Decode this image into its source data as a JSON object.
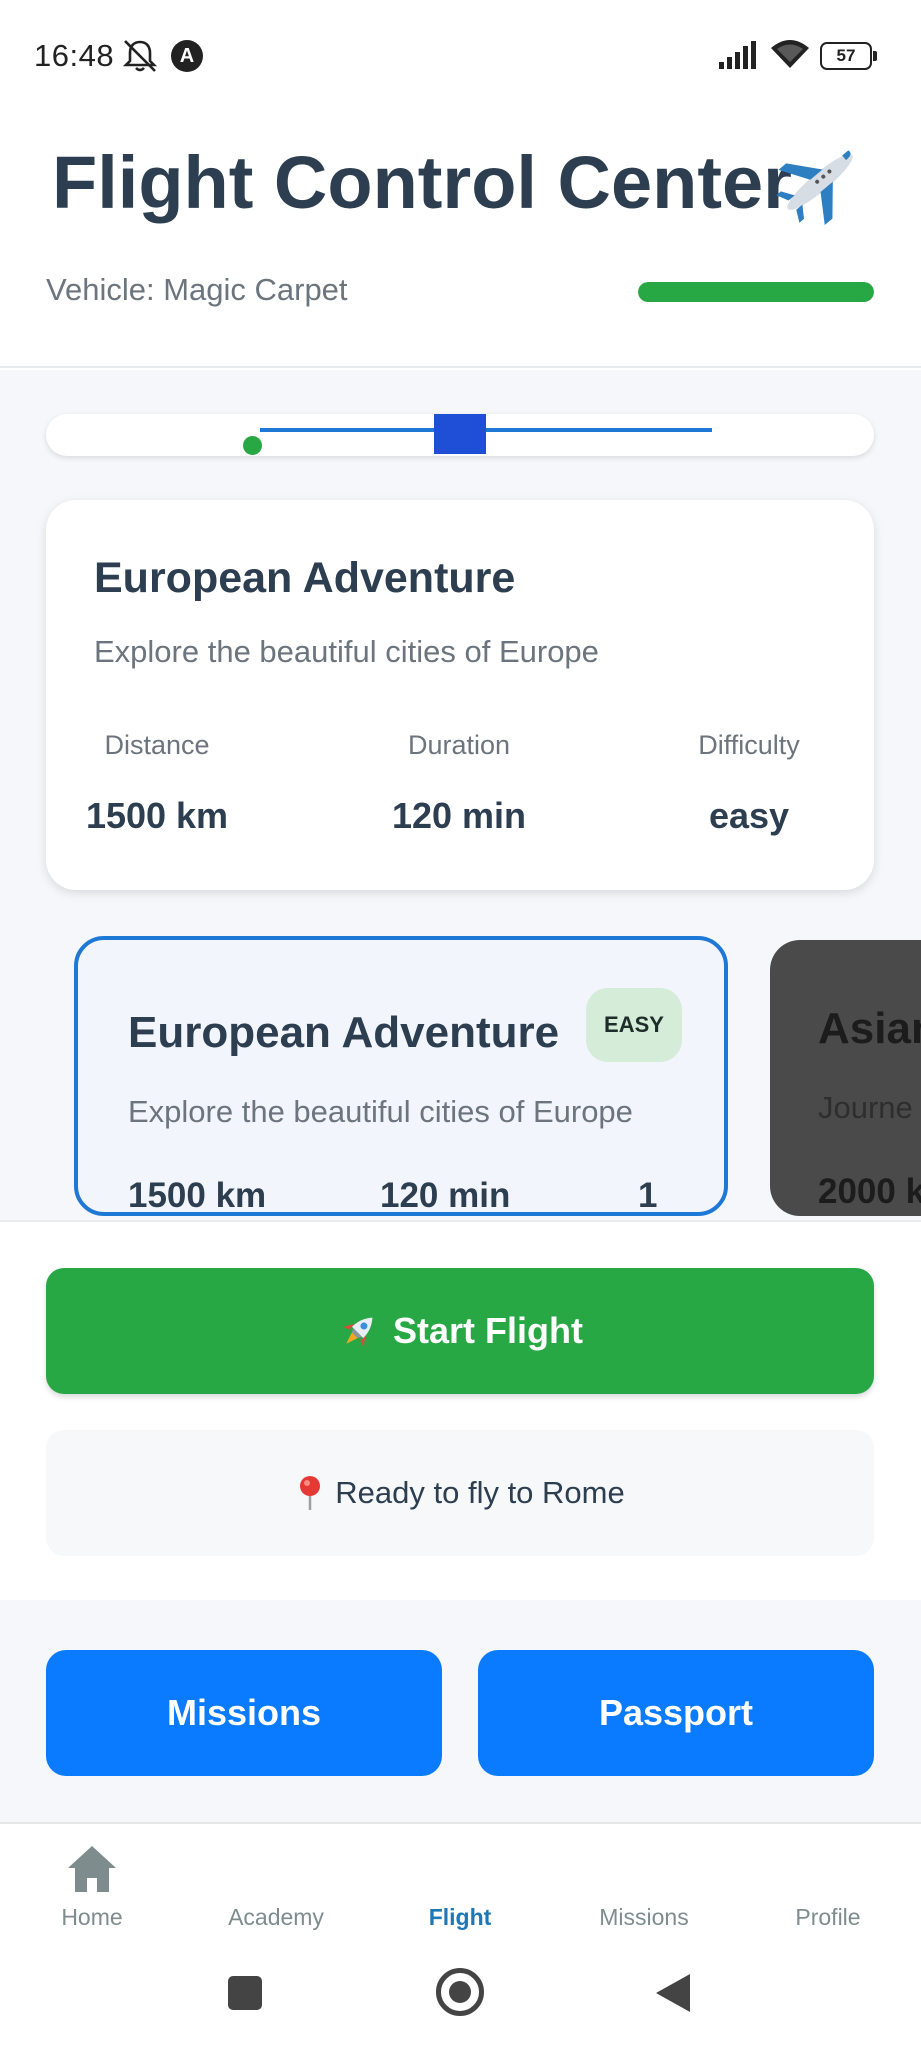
{
  "status_bar": {
    "time": "16:48",
    "app_icon_letter": "A",
    "battery": "57",
    "icons": [
      "bell-muted-icon",
      "signal-icon",
      "wifi-icon",
      "battery-icon"
    ]
  },
  "header": {
    "title": "Flight Control Center",
    "title_icon": "airplane-icon",
    "vehicle_label": "Vehicle: Magic Carpet",
    "vehicle_bar_percent": 100,
    "accent_color": "#28a745"
  },
  "route_strip": {
    "progress_percent": 35
  },
  "info_card": {
    "title": "European Adventure",
    "description": "Explore the beautiful cities of Europe",
    "stats": [
      {
        "label": "Distance",
        "value": "1500 km"
      },
      {
        "label": "Duration",
        "value": "120 min"
      },
      {
        "label": "Difficulty",
        "value": "easy"
      }
    ]
  },
  "route_cards": [
    {
      "title": "European Adventure",
      "badge": "EASY",
      "description": "Explore the beautiful cities of Europe",
      "distance": "1500 km",
      "duration": "120 min",
      "count": "1",
      "selected": true
    },
    {
      "title": "Asian",
      "description": "Journe",
      "distance": "2000 k",
      "selected": false
    }
  ],
  "actions": {
    "start_label": "Start Flight",
    "start_icon": "rocket-icon",
    "status_text": "Ready to fly to Rome",
    "status_icon": "pin-icon"
  },
  "nav_buttons": {
    "missions": "Missions",
    "passport": "Passport"
  },
  "tabbar": {
    "items": [
      {
        "label": "Home",
        "icon": "home-icon"
      },
      {
        "label": "Academy"
      },
      {
        "label": "Flight",
        "active": true
      },
      {
        "label": "Missions"
      },
      {
        "label": "Profile"
      }
    ]
  }
}
